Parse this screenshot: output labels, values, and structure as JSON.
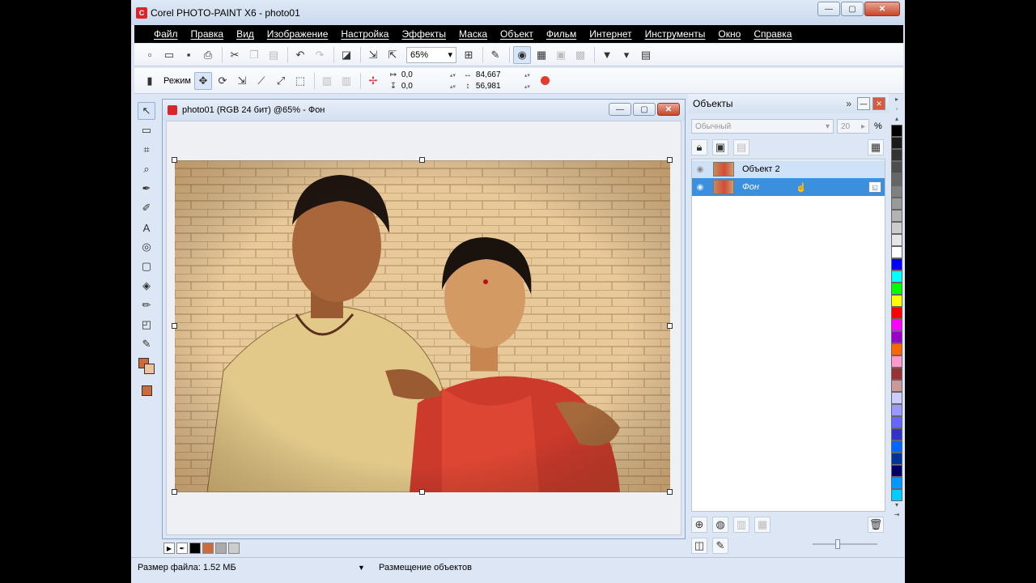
{
  "app": {
    "title": "Corel PHOTO-PAINT X6 - photo01",
    "icon_label": "C"
  },
  "window_buttons": {
    "minimize": "—",
    "maximize": "▢",
    "close": "✕"
  },
  "menu": [
    {
      "label": "Файл"
    },
    {
      "label": "Правка"
    },
    {
      "label": "Вид"
    },
    {
      "label": "Изображение"
    },
    {
      "label": "Настройка"
    },
    {
      "label": "Эффекты"
    },
    {
      "label": "Маска"
    },
    {
      "label": "Объект"
    },
    {
      "label": "Фильм"
    },
    {
      "label": "Интернет"
    },
    {
      "label": "Инструменты"
    },
    {
      "label": "Окно"
    },
    {
      "label": "Справка"
    }
  ],
  "toolbar": {
    "zoom_value": "65%"
  },
  "property_bar": {
    "mode_label": "Режим",
    "x_value": "0,0",
    "y_value": "0,0",
    "width_value": "84,667",
    "height_value": "56,981",
    "x_label": "↦",
    "y_label": "↧",
    "w_label": "↔",
    "h_label": "↕"
  },
  "document": {
    "title": "photo01 (RGB 24 бит) @65% - Фон"
  },
  "status": {
    "file_size": "Размер файла: 1.52 МБ",
    "message": "Размещение объектов"
  },
  "objects_panel": {
    "title": "Объекты",
    "blend_mode": "Обычный",
    "opacity": "20",
    "opacity_unit": "%",
    "objects": [
      {
        "name": "Объект 2"
      },
      {
        "name": "Фон"
      }
    ]
  },
  "palette_colors": [
    "#000000",
    "#1a1a1a",
    "#333333",
    "#4d4d4d",
    "#666666",
    "#808080",
    "#999999",
    "#b3b3b3",
    "#cccccc",
    "#e6e6e6",
    "#ffffff",
    "#0000ff",
    "#00ffff",
    "#00ff00",
    "#ffff00",
    "#ff0000",
    "#ff00ff",
    "#9900cc",
    "#ff6600",
    "#ff99cc",
    "#993333",
    "#cc9999",
    "#ccccff",
    "#9999ff",
    "#6666ff",
    "#3333cc",
    "#0066ff",
    "#003399",
    "#000066",
    "#0099ff",
    "#00ccff"
  ],
  "colors": {
    "fg_color": "#c96b3d",
    "bg_color": "#f0c29a",
    "accent": "#3b8fdf"
  }
}
